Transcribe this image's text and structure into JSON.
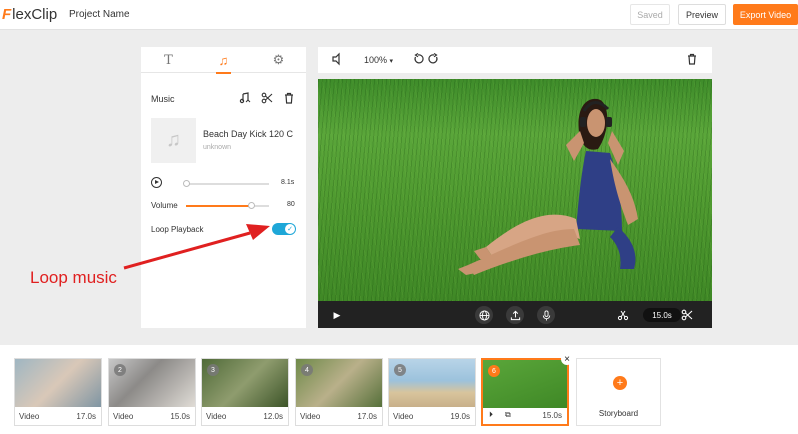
{
  "app": {
    "logo_mark": "F",
    "logo_text": "lexClip",
    "project_name": "Project Name"
  },
  "header": {
    "saved_label": "Saved",
    "preview_label": "Preview",
    "export_label": "Export Video",
    "accent": "#ff7a1a"
  },
  "panel": {
    "tabs": [
      {
        "icon": "text-icon",
        "glyph": "T"
      },
      {
        "icon": "music-note-icon",
        "glyph": "♫"
      },
      {
        "icon": "gear-icon",
        "glyph": "⚙"
      }
    ],
    "active_tab": 1,
    "music_title": "Music",
    "track_name": "Beach Day Kick 120 C",
    "track_artist": "unknown",
    "duration_value": "8.1s",
    "volume_label": "Volume",
    "volume_value": "80",
    "volume_level": 0.8,
    "loop_label": "Loop Playback",
    "loop_on": true,
    "toggle_color": "#1ea7d8"
  },
  "video_toolbar": {
    "zoom": "100%"
  },
  "video_controls": {
    "duration": "15.0s"
  },
  "timeline": {
    "clips": [
      {
        "num": "",
        "type": "Video",
        "duration": "17.0s"
      },
      {
        "num": "2",
        "type": "Video",
        "duration": "15.0s"
      },
      {
        "num": "3",
        "type": "Video",
        "duration": "12.0s"
      },
      {
        "num": "4",
        "type": "Video",
        "duration": "17.0s"
      },
      {
        "num": "5",
        "type": "Video",
        "duration": "19.0s"
      },
      {
        "num": "6",
        "type": "",
        "duration": "15.0s"
      }
    ],
    "storyboard_label": "Storyboard"
  },
  "annotation": {
    "text": "Loop music",
    "color": "#e02020"
  }
}
